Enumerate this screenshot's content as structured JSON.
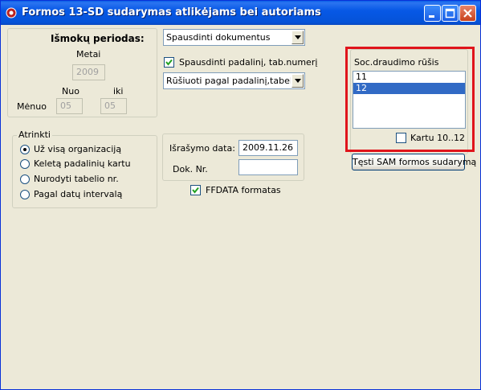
{
  "window": {
    "title": "Formos 13-SD sudarymas atlikėjams bei autoriams"
  },
  "period": {
    "heading": "Išmokų periodas:",
    "year_label": "Metai",
    "year_value": "2009",
    "from_label": "Nuo",
    "to_label": "iki",
    "month_label": "Mėnuo",
    "month_from": "05",
    "month_to": "05"
  },
  "print": {
    "combo_value": "Spausdinti dokumentus",
    "print_tab_label": "Spausdinti padalinį, tab.numerį",
    "print_tab_checked": true,
    "sort_value": "Rūšiuoti pagal padalinį,tabelio nr"
  },
  "select": {
    "legend": "Atrinkti",
    "options": [
      {
        "label": "Už visą organizaciją",
        "selected": true
      },
      {
        "label": "Keletą padalinių kartu",
        "selected": false
      },
      {
        "label": "Nurodyti tabelio nr.",
        "selected": false
      },
      {
        "label": "Pagal datų intervalą",
        "selected": false
      }
    ]
  },
  "doc": {
    "date_label": "Išrašymo data:",
    "date_value": "2009.11.26",
    "number_label": "Dok. Nr.",
    "number_value": "",
    "ffdata_label": "FFDATA formatas",
    "ffdata_checked": true
  },
  "soc": {
    "label": "Soc.draudimo rūšis",
    "items": [
      {
        "value": "11",
        "selected": false
      },
      {
        "value": "12",
        "selected": true
      }
    ],
    "kartu_label": "Kartu 10..12",
    "kartu_checked": false
  },
  "actions": {
    "continue_label": "Tęsti SAM formos sudarymą"
  },
  "colors": {
    "title_bar": "#0758e6",
    "highlight": "#e0141b",
    "selection": "#316ac5"
  }
}
